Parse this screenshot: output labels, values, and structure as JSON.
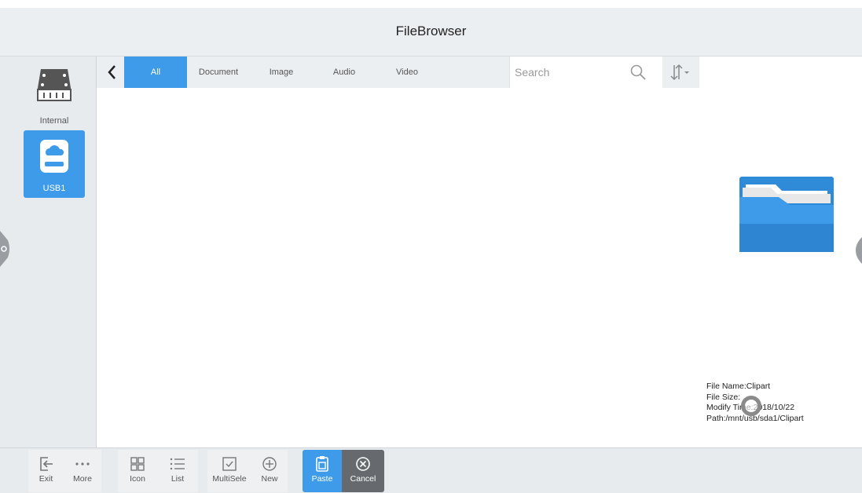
{
  "app": {
    "title": "FileBrowser"
  },
  "sidebar": {
    "drives": [
      {
        "label": "Internal",
        "active": false
      },
      {
        "label": "USB1",
        "active": true
      }
    ]
  },
  "tabs": [
    {
      "label": "All",
      "active": true
    },
    {
      "label": "Document",
      "active": false
    },
    {
      "label": "Image",
      "active": false
    },
    {
      "label": "Audio",
      "active": false
    },
    {
      "label": "Video",
      "active": false
    }
  ],
  "search": {
    "placeholder": "Search",
    "value": ""
  },
  "preview": {
    "file_name": "File Name:Clipart",
    "file_size": "File Size:",
    "modify_time": "Modify Time:2018/10/22",
    "path": "Path:/mnt/usb/sda1/Clipart"
  },
  "toolbar": {
    "exit": "Exit",
    "more": "More",
    "icon": "Icon",
    "list": "List",
    "multiselect": "MultiSele",
    "new": "New",
    "paste": "Paste",
    "cancel": "Cancel"
  },
  "colors": {
    "accent": "#3d9be9",
    "cancel": "#666a6e",
    "folder": "#2f8ad8"
  }
}
